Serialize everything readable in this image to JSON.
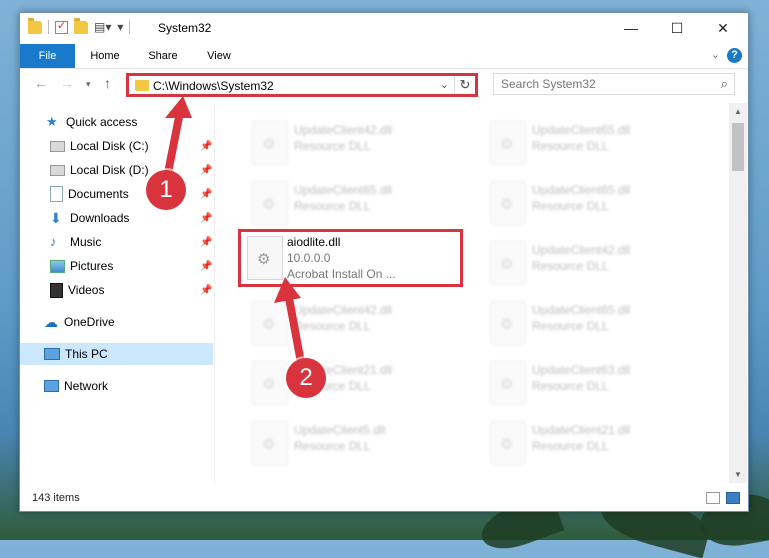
{
  "window": {
    "title": "System32",
    "controls": {
      "minimize": "—",
      "maximize": "☐",
      "close": "✕"
    }
  },
  "ribbon": {
    "tabs": [
      "File",
      "Home",
      "Share",
      "View"
    ],
    "help": "?"
  },
  "address": {
    "path": "C:\\Windows\\System32"
  },
  "search": {
    "placeholder": "Search System32"
  },
  "sidebar": {
    "items": [
      {
        "label": "Quick access",
        "icon": "star-icon",
        "pinned": false
      },
      {
        "label": "Local Disk (C:)",
        "icon": "drive-icon",
        "pinned": true
      },
      {
        "label": "Local Disk (D:)",
        "icon": "drive-icon",
        "pinned": true
      },
      {
        "label": "Documents",
        "icon": "documents-icon",
        "pinned": true
      },
      {
        "label": "Downloads",
        "icon": "download-icon",
        "pinned": true
      },
      {
        "label": "Music",
        "icon": "music-icon",
        "pinned": true
      },
      {
        "label": "Pictures",
        "icon": "pictures-icon",
        "pinned": true
      },
      {
        "label": "Videos",
        "icon": "videos-icon",
        "pinned": true
      },
      {
        "label": "OneDrive",
        "icon": "cloud-icon",
        "pinned": false
      },
      {
        "label": "This PC",
        "icon": "computer-icon",
        "pinned": false,
        "selected": true
      },
      {
        "label": "Network",
        "icon": "network-icon",
        "pinned": false
      }
    ]
  },
  "files": {
    "left": [
      {
        "name": "UpdateClient42.dll",
        "sub": "Resource DLL"
      },
      {
        "name": "UpdateClient65.dll",
        "sub": "Resource DLL"
      },
      null,
      {
        "name": "UpdateClient42.dll",
        "sub": "Resource DLL"
      },
      {
        "name": "UpdateClient21.dll",
        "sub": "Resource DLL"
      },
      {
        "name": "UpdateClient5.dll",
        "sub": "Resource DLL"
      }
    ],
    "right": [
      {
        "name": "UpdateClient65.dll",
        "sub": "Resource DLL"
      },
      {
        "name": "UpdateClient65.dll",
        "sub": "Resource DLL"
      },
      {
        "name": "UpdateClient42.dll",
        "sub": "Resource DLL"
      },
      {
        "name": "UpdateClient65.dll",
        "sub": "Resource DLL"
      },
      {
        "name": "UpdateClient63.dll",
        "sub": "Resource DLL"
      },
      {
        "name": "UpdateClient21.dll",
        "sub": "Resource DLL"
      }
    ],
    "highlighted": {
      "name": "aiodlite.dll",
      "version": "10.0.0.0",
      "description": "Acrobat Install On ..."
    }
  },
  "status": {
    "count": "143 items"
  },
  "annotations": {
    "step1": "1",
    "step2": "2",
    "color": "#d9343d"
  }
}
